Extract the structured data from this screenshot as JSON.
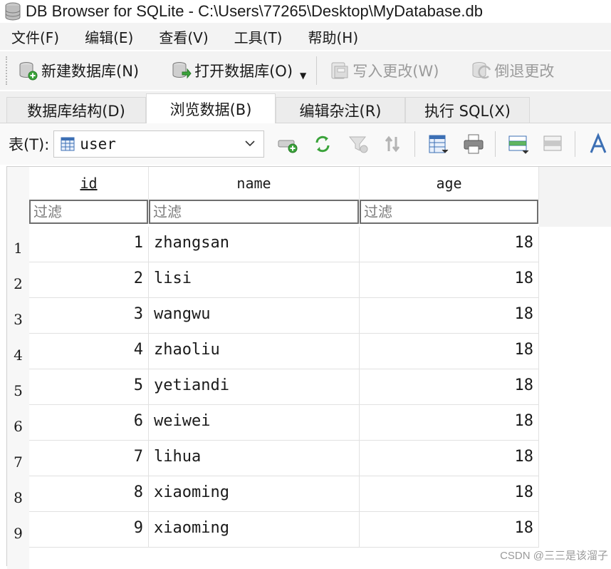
{
  "window": {
    "title": "DB Browser for SQLite - C:\\Users\\77265\\Desktop\\MyDatabase.db"
  },
  "menu": [
    "文件(F)",
    "编辑(E)",
    "查看(V)",
    "工具(T)",
    "帮助(H)"
  ],
  "toolbar": {
    "new_db": "新建数据库(N)",
    "open_db": "打开数据库(O)",
    "write_changes": "写入更改(W)",
    "revert_changes": "倒退更改"
  },
  "tabs": [
    "数据库结构(D)",
    "浏览数据(B)",
    "编辑杂注(R)",
    "执行 SQL(X)"
  ],
  "active_tab": 1,
  "browse": {
    "table_label": "表(T):",
    "selected_table": "user"
  },
  "grid": {
    "columns": [
      "id",
      "name",
      "age"
    ],
    "filter_placeholder": "过滤",
    "rows": [
      {
        "num": "1",
        "id": "1",
        "name": "zhangsan",
        "age": "18"
      },
      {
        "num": "2",
        "id": "2",
        "name": "lisi",
        "age": "18"
      },
      {
        "num": "3",
        "id": "3",
        "name": "wangwu",
        "age": "18"
      },
      {
        "num": "4",
        "id": "4",
        "name": "zhaoliu",
        "age": "18"
      },
      {
        "num": "5",
        "id": "5",
        "name": "yetiandi",
        "age": "18"
      },
      {
        "num": "6",
        "id": "6",
        "name": "weiwei",
        "age": "18"
      },
      {
        "num": "7",
        "id": "7",
        "name": "lihua",
        "age": "18"
      },
      {
        "num": "8",
        "id": "8",
        "name": "xiaoming",
        "age": "18"
      },
      {
        "num": "9",
        "id": "9",
        "name": "xiaoming",
        "age": "18"
      }
    ]
  },
  "watermark": "CSDN @三三是该溜子",
  "colors": {
    "toolbar_bg": "#f3f3f3",
    "filter_border": "#6e6e6e",
    "disabled_text": "#9a9a9a"
  }
}
